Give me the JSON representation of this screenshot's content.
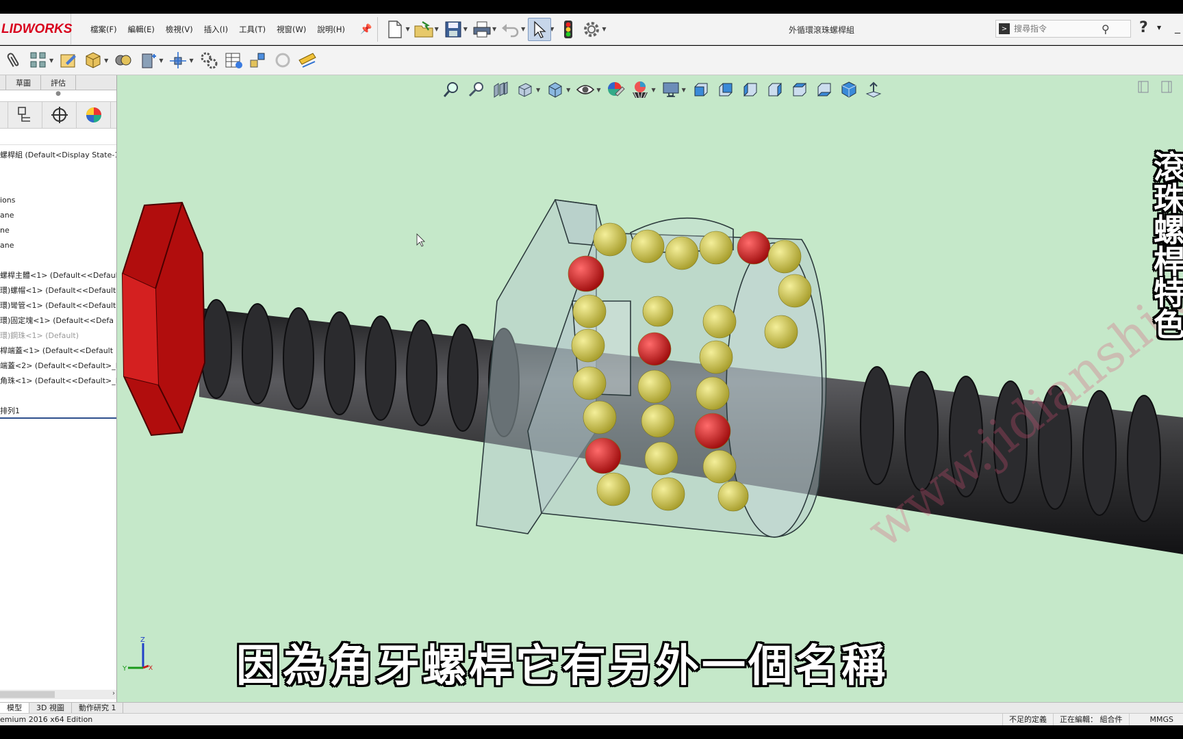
{
  "app": {
    "logo_text": "LIDWORKS",
    "document_title": "外循環滾珠螺桿組"
  },
  "menu": [
    "檔案(F)",
    "編輯(E)",
    "檢視(V)",
    "插入(I)",
    "工具(T)",
    "視窗(W)",
    "說明(H)"
  ],
  "search": {
    "placeholder": "搜尋指令"
  },
  "panel": {
    "tabs": [
      "",
      "草圖",
      "評估"
    ],
    "tree": [
      {
        "label": "螺桿組  (Default<Display State-1",
        "dim": false
      },
      {
        "label": "",
        "dim": false
      },
      {
        "label": "",
        "dim": false
      },
      {
        "label": "ions",
        "dim": false
      },
      {
        "label": "ane",
        "dim": false
      },
      {
        "label": "ne",
        "dim": false
      },
      {
        "label": "ane",
        "dim": false
      },
      {
        "label": "",
        "dim": false
      },
      {
        "label": "螺桿主體<1> (Default<<Defaul",
        "dim": false
      },
      {
        "label": "環)螺帽<1> (Default<<Default",
        "dim": false
      },
      {
        "label": "環)彎管<1> (Default<<Default",
        "dim": false
      },
      {
        "label": "環)固定塊<1> (Default<<Defa",
        "dim": false
      },
      {
        "label": "環)鋼珠<1> (Default)",
        "dim": true
      },
      {
        "label": "桿端蓋<1> (Default<<Default",
        "dim": false
      },
      {
        "label": "端蓋<2> (Default<<Default>_D",
        "dim": false
      },
      {
        "label": "角珠<1> (Default<<Default>_D",
        "dim": false
      },
      {
        "label": "",
        "dim": false
      },
      {
        "label": "排列1",
        "dim": false
      }
    ]
  },
  "viewport": {
    "subtitle": "因為角牙螺桿它有另外一個名稱",
    "vertical_title": "滾珠螺桿特色",
    "watermark": "www.jidianshi.c",
    "triad": {
      "z": "Z",
      "y": "Y",
      "x": "X"
    }
  },
  "bottom_tabs": [
    "模型",
    "3D 視圖",
    "動作研究 1"
  ],
  "status": {
    "edition": "emium 2016 x64 Edition",
    "definition": "不足的定義",
    "editing": "正在編輯： 組合件",
    "units": "MMGS"
  },
  "colors": {
    "viewport_bg": "#c5e8c9",
    "nut_red": "#cc1414",
    "ball_yellow": "#d6cf4a",
    "ball_red": "#d41b1b",
    "screw": "#3a3a3c",
    "brand": "#d8001c"
  }
}
